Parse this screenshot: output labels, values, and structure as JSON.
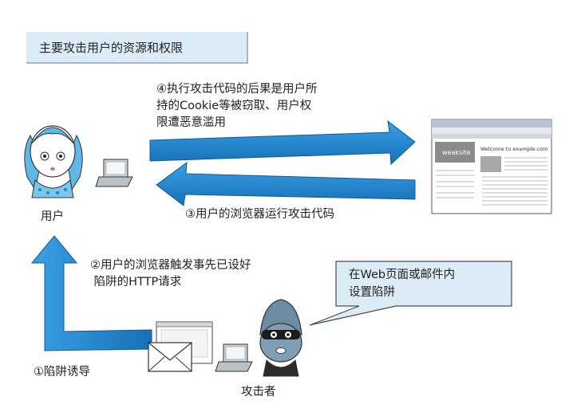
{
  "title": "主要攻击用户的资源和权限",
  "step4_text": "④执行攻击代码的后果是用户所\n持的Cookie等被窃取、用户权\n限遭恶意滥用",
  "step3_text": "③用户的浏览器运行攻击代码",
  "step2_text": "②用户的浏览器触发事先已设好\n 陷阱的HTTP请求",
  "step1_text": "①陷阱诱导",
  "bubble_text": "在Web页面或邮件内\n设置陷阱",
  "user_label": "用户",
  "attacker_label": "攻击者",
  "browser": {
    "site_name": "weaksite",
    "welcome": "Welcome to example.com"
  },
  "colors": {
    "arrow": "#1e86d2",
    "arrow_dark": "#1565a8",
    "title_bg": "#dbecf6",
    "bubble_bg": "#dbecf6"
  }
}
